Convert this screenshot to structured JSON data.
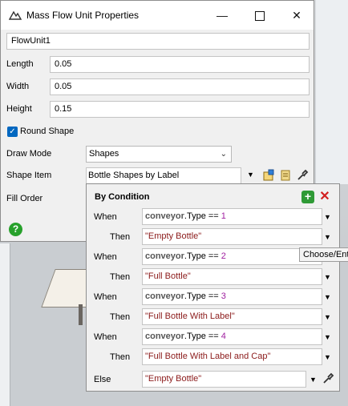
{
  "dialog": {
    "title": "Mass Flow Unit Properties",
    "name_value": "FlowUnit1",
    "length": {
      "label": "Length",
      "value": "0.05"
    },
    "width": {
      "label": "Width",
      "value": "0.05"
    },
    "height": {
      "label": "Height",
      "value": "0.15"
    },
    "round_shape": {
      "label": "Round Shape",
      "checked": true
    },
    "draw_mode": {
      "label": "Draw Mode",
      "value": "Shapes"
    },
    "shape_item": {
      "label": "Shape Item",
      "value": "Bottle Shapes by Label"
    },
    "fill_order": {
      "label": "Fill Order"
    }
  },
  "popup": {
    "title": "By Condition",
    "conditions": [
      {
        "when_label": "When",
        "object": "conveyor",
        "prop": ".Type ==",
        "num": "1",
        "then_label": "Then",
        "then_value": "\"Empty Bottle\""
      },
      {
        "when_label": "When",
        "object": "conveyor",
        "prop": ".Type ==",
        "num": "2",
        "then_label": "Then",
        "then_value": "\"Full Bottle\""
      },
      {
        "when_label": "When",
        "object": "conveyor",
        "prop": ".Type ==",
        "num": "3",
        "then_label": "Then",
        "then_value": "\"Full Bottle With Label\""
      },
      {
        "when_label": "When",
        "object": "conveyor",
        "prop": ".Type ==",
        "num": "4",
        "then_label": "Then",
        "then_value": "\"Full Bottle With Label and Cap\""
      }
    ],
    "else_label": "Else",
    "else_value": "\"Empty Bottle\""
  },
  "tooltip": "Choose/Ent",
  "colors": {
    "accent": "#0067c0",
    "string": "#8b1a1a",
    "number": "#a020a0",
    "add": "#2f9a36",
    "remove": "#d21f1f"
  },
  "icons": [
    "app-icon",
    "minimize-icon",
    "maximize-icon",
    "close-icon",
    "chevron-down-icon",
    "edit-icon",
    "script-icon",
    "eyedropper-icon",
    "help-icon",
    "add-icon",
    "remove-icon"
  ]
}
